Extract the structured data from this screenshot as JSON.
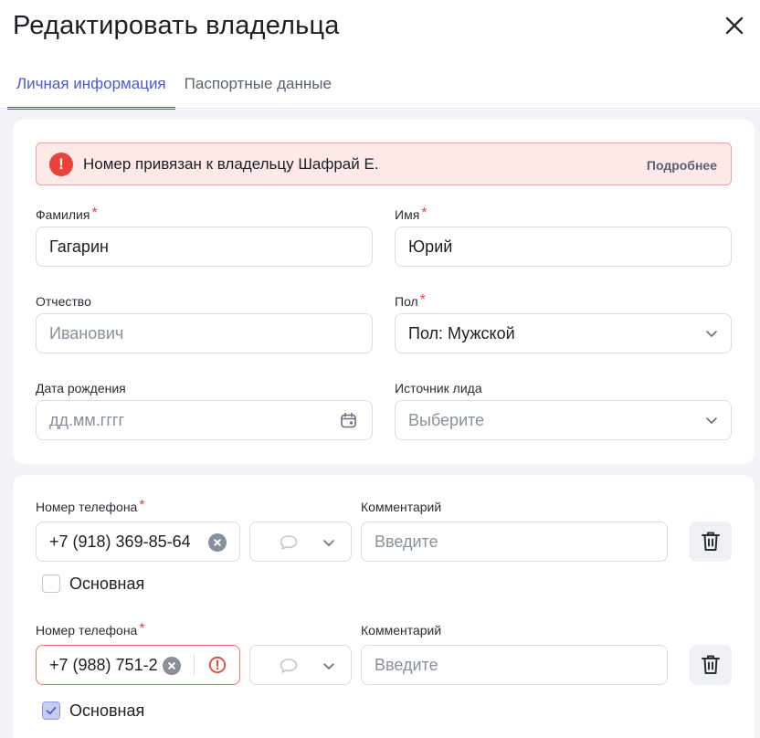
{
  "dialog": {
    "title": "Редактировать владельца"
  },
  "tabs": [
    {
      "label": "Личная информация",
      "active": true
    },
    {
      "label": "Паспортные данные",
      "active": false
    }
  ],
  "alert": {
    "icon_text": "!",
    "message": "Номер привязан к владельцу Шафрай Е.",
    "link": "Подробнее"
  },
  "form": {
    "last_name": {
      "label": "Фамилия",
      "required": "*",
      "value": "Гагарин"
    },
    "first_name": {
      "label": "Имя",
      "required": "*",
      "value": "Юрий"
    },
    "middle_name": {
      "label": "Отчество",
      "placeholder": "Иванович"
    },
    "gender": {
      "label": "Пол",
      "required": "*",
      "value": "Пол: Мужской"
    },
    "birth_date": {
      "label": "Дата рождения",
      "placeholder": "дд.мм.гггг"
    },
    "lead_source": {
      "label": "Источник лида",
      "placeholder": "Выберите"
    }
  },
  "phones": [
    {
      "phone_label": "Номер телефона",
      "required": "*",
      "value": "+7 (918) 369-85-64",
      "comment_label": "Комментарий",
      "comment_placeholder": "Введите",
      "primary_label": "Основная",
      "primary_checked": false,
      "error": false
    },
    {
      "phone_label": "Номер телефона",
      "required": "*",
      "value": "+7 (988) 751-2",
      "comment_label": "Комментарий",
      "comment_placeholder": "Введите",
      "primary_label": "Основная",
      "primary_checked": true,
      "error": true
    }
  ],
  "colors": {
    "accent": "#4a59d0",
    "error": "#e8423a",
    "alert_bg": "#fde9e8"
  }
}
